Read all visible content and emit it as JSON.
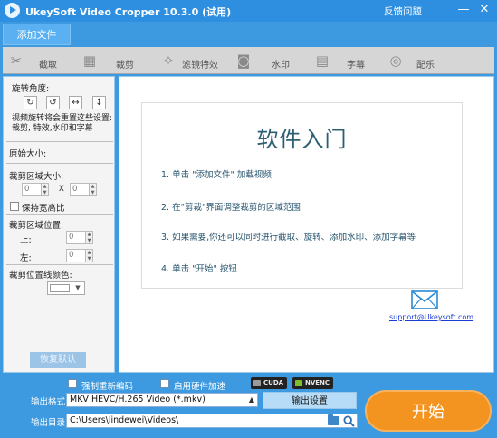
{
  "window": {
    "title": "UkeySoft Video Cropper 10.3.0 (试用)",
    "feedback_label": "反馈问题",
    "minimize_glyph": "—",
    "close_glyph": "✕"
  },
  "toolbar": {
    "add_file_label": "添加文件"
  },
  "tabs": [
    {
      "label": "截取",
      "icon": "scissors-icon"
    },
    {
      "label": "裁剪",
      "icon": "crop-icon"
    },
    {
      "label": "滤镜特效",
      "icon": "effects-icon"
    },
    {
      "label": "水印",
      "icon": "watermark-icon"
    },
    {
      "label": "字幕",
      "icon": "subtitle-icon"
    },
    {
      "label": "配乐",
      "icon": "music-icon"
    }
  ],
  "left_panel": {
    "rotation_label": "旋转角度:",
    "rotation_note": "视频旋转将会重置这些设置:\n裁剪, 特效,水印和字幕",
    "original_size_label": "原始大小:",
    "crop_size_label": "裁剪区域大小:",
    "crop_width": "0",
    "crop_height": "0",
    "size_separator": "X",
    "keep_ratio_label": "保持宽高比",
    "crop_position_label": "裁剪区域位置:",
    "top_label": "上:",
    "top_value": "0",
    "left_label": "左:",
    "left_value": "0",
    "line_color_label": "裁剪位置线颜色:",
    "line_color": "#ffffff",
    "reset_label": "恢复默认"
  },
  "guide": {
    "title": "软件入门",
    "steps": [
      "1. 单击 \"添加文件\" 加载视频",
      "2. 在\"剪裁\"界面调整裁剪的区域范围",
      "3. 如果需要,你还可以同时进行截取、旋转、添加水印、添加字幕等",
      "4. 单击 \"开始\" 按钮"
    ],
    "support_email": "support@Ukeysoft.com"
  },
  "bottom": {
    "force_reencode_label": "强制重新编码",
    "hw_accel_label": "启用硬件加速",
    "gpu_badges": [
      "CUDA",
      "NVENC"
    ],
    "output_format_label": "输出格式:",
    "output_format_value": "MKV HEVC/H.265 Video (*.mkv)",
    "output_settings_label": "输出设置",
    "output_dir_label": "输出目录:",
    "output_dir_value": "C:\\Users\\lindewei\\Videos\\",
    "start_label": "开始"
  },
  "colors": {
    "accent": "#2e8fe0",
    "start_button": "#f39320"
  }
}
